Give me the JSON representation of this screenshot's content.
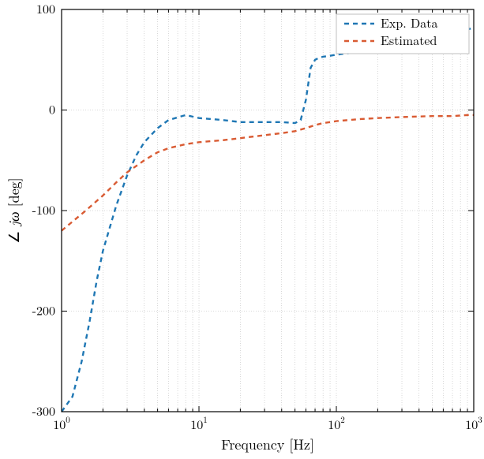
{
  "chart_data": {
    "type": "line",
    "title": "",
    "xlabel": "Frequency [Hz]",
    "ylabel": "jω [deg]",
    "xlim": [
      1,
      1000
    ],
    "ylim": [
      -300,
      100
    ],
    "xscale": "log",
    "grid": true,
    "legend_position": "upper-right",
    "series": [
      {
        "name": "Exp. Data",
        "color": "#1f77b4",
        "dash": "6 5",
        "width": 2.4,
        "x": [
          1,
          1.2,
          1.4,
          1.6,
          1.8,
          2.0,
          2.5,
          3.0,
          3.5,
          4.0,
          5.0,
          6.0,
          8.0,
          10,
          15,
          20,
          30,
          40,
          50,
          55,
          60,
          65,
          70,
          75,
          80,
          90,
          100,
          150,
          200,
          300,
          500,
          700,
          900,
          1000
        ],
        "y": [
          -300,
          -285,
          -250,
          -210,
          -170,
          -140,
          -95,
          -65,
          -45,
          -32,
          -18,
          -10,
          -5,
          -8,
          -10,
          -12,
          -12,
          -12,
          -13,
          -10,
          10,
          42,
          50,
          52,
          53,
          54,
          55,
          58,
          60,
          64,
          70,
          75,
          80,
          82
        ]
      },
      {
        "name": "Estimated",
        "color": "#d95b33",
        "dash": "6 5",
        "width": 2.4,
        "x": [
          1,
          1.5,
          2.0,
          2.5,
          3.0,
          4.0,
          5.0,
          6.0,
          8.0,
          10,
          15,
          20,
          30,
          40,
          50,
          60,
          70,
          80,
          90,
          100,
          150,
          200,
          300,
          500,
          700,
          900,
          1000
        ],
        "y": [
          -120,
          -100,
          -85,
          -72,
          -62,
          -50,
          -42,
          -38,
          -34,
          -32,
          -30,
          -28,
          -25,
          -23,
          -21,
          -18,
          -15,
          -13,
          -12,
          -11,
          -9,
          -8,
          -7,
          -6,
          -6,
          -5,
          -5
        ]
      }
    ],
    "ytick_values": [
      -300,
      -200,
      -100,
      0,
      100
    ],
    "xtick_decades": [
      1,
      10,
      100,
      1000
    ],
    "xtick_labels": [
      "10^0",
      "10^1",
      "10^2",
      "10^3"
    ]
  }
}
